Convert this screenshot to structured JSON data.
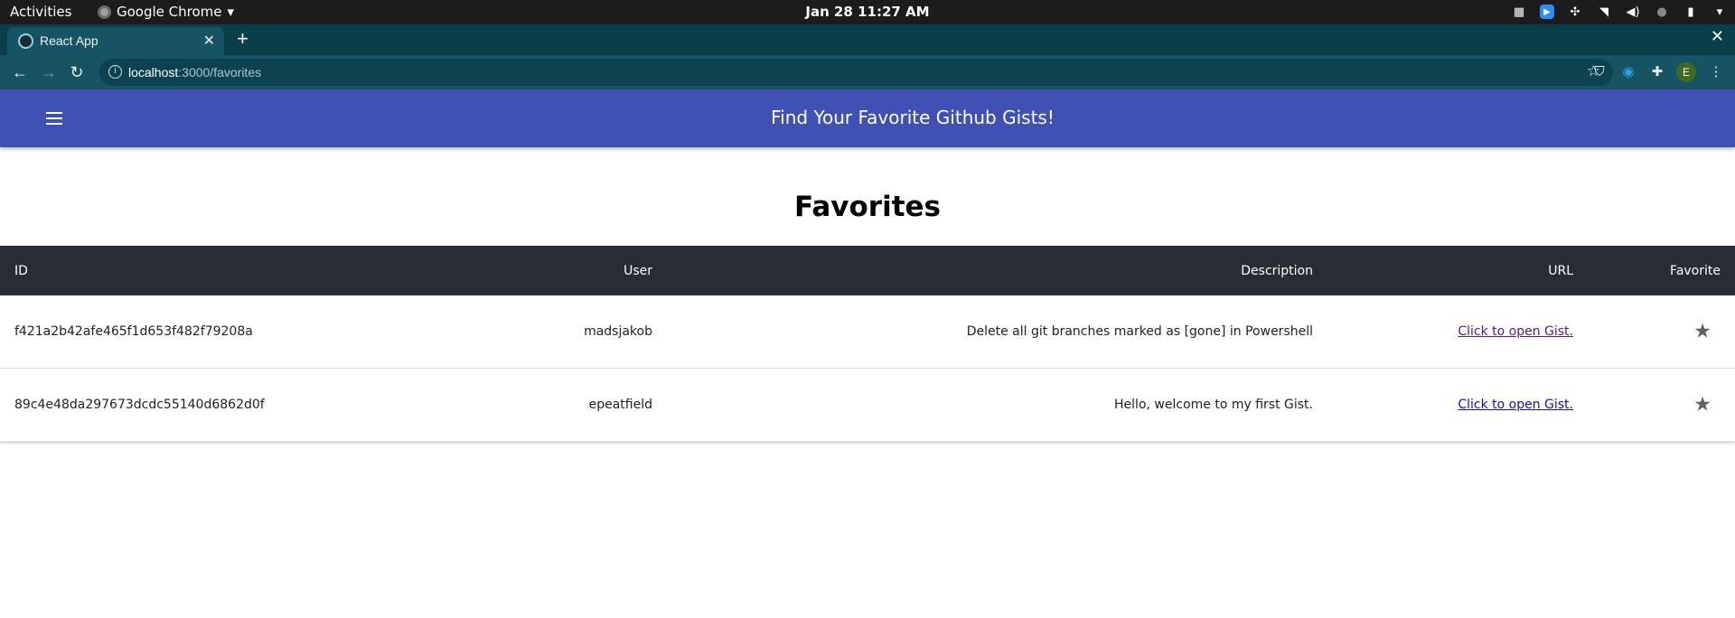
{
  "system_bar": {
    "activities": "Activities",
    "app_name": "Google Chrome",
    "clock": "Jan 28  11:27 AM"
  },
  "browser": {
    "tab_title": "React App",
    "url_host": "localhost",
    "url_path": ":3000/favorites",
    "profile_initial": "E"
  },
  "app": {
    "title": "Find Your Favorite Github Gists!",
    "heading": "Favorites"
  },
  "table": {
    "headers": {
      "id": "ID",
      "user": "User",
      "description": "Description",
      "url": "URL",
      "favorite": "Favorite"
    },
    "rows": [
      {
        "id": "f421a2b42afe465f1d653f482f79208a",
        "user": "madsjakob",
        "description": "Delete all git branches marked as [gone] in Powershell",
        "url_label": "Click to open Gist.",
        "favorite_icon": "star-icon"
      },
      {
        "id": "89c4e48da297673dcdc55140d6862d0f",
        "user": "epeatfield",
        "description": "Hello, welcome to my first Gist.",
        "url_label": "Click to open Gist.",
        "favorite_icon": "star-icon"
      }
    ]
  },
  "colors": {
    "appbar": "#3f51b5",
    "table_header": "#282c34",
    "browser_frame": "#175463"
  }
}
